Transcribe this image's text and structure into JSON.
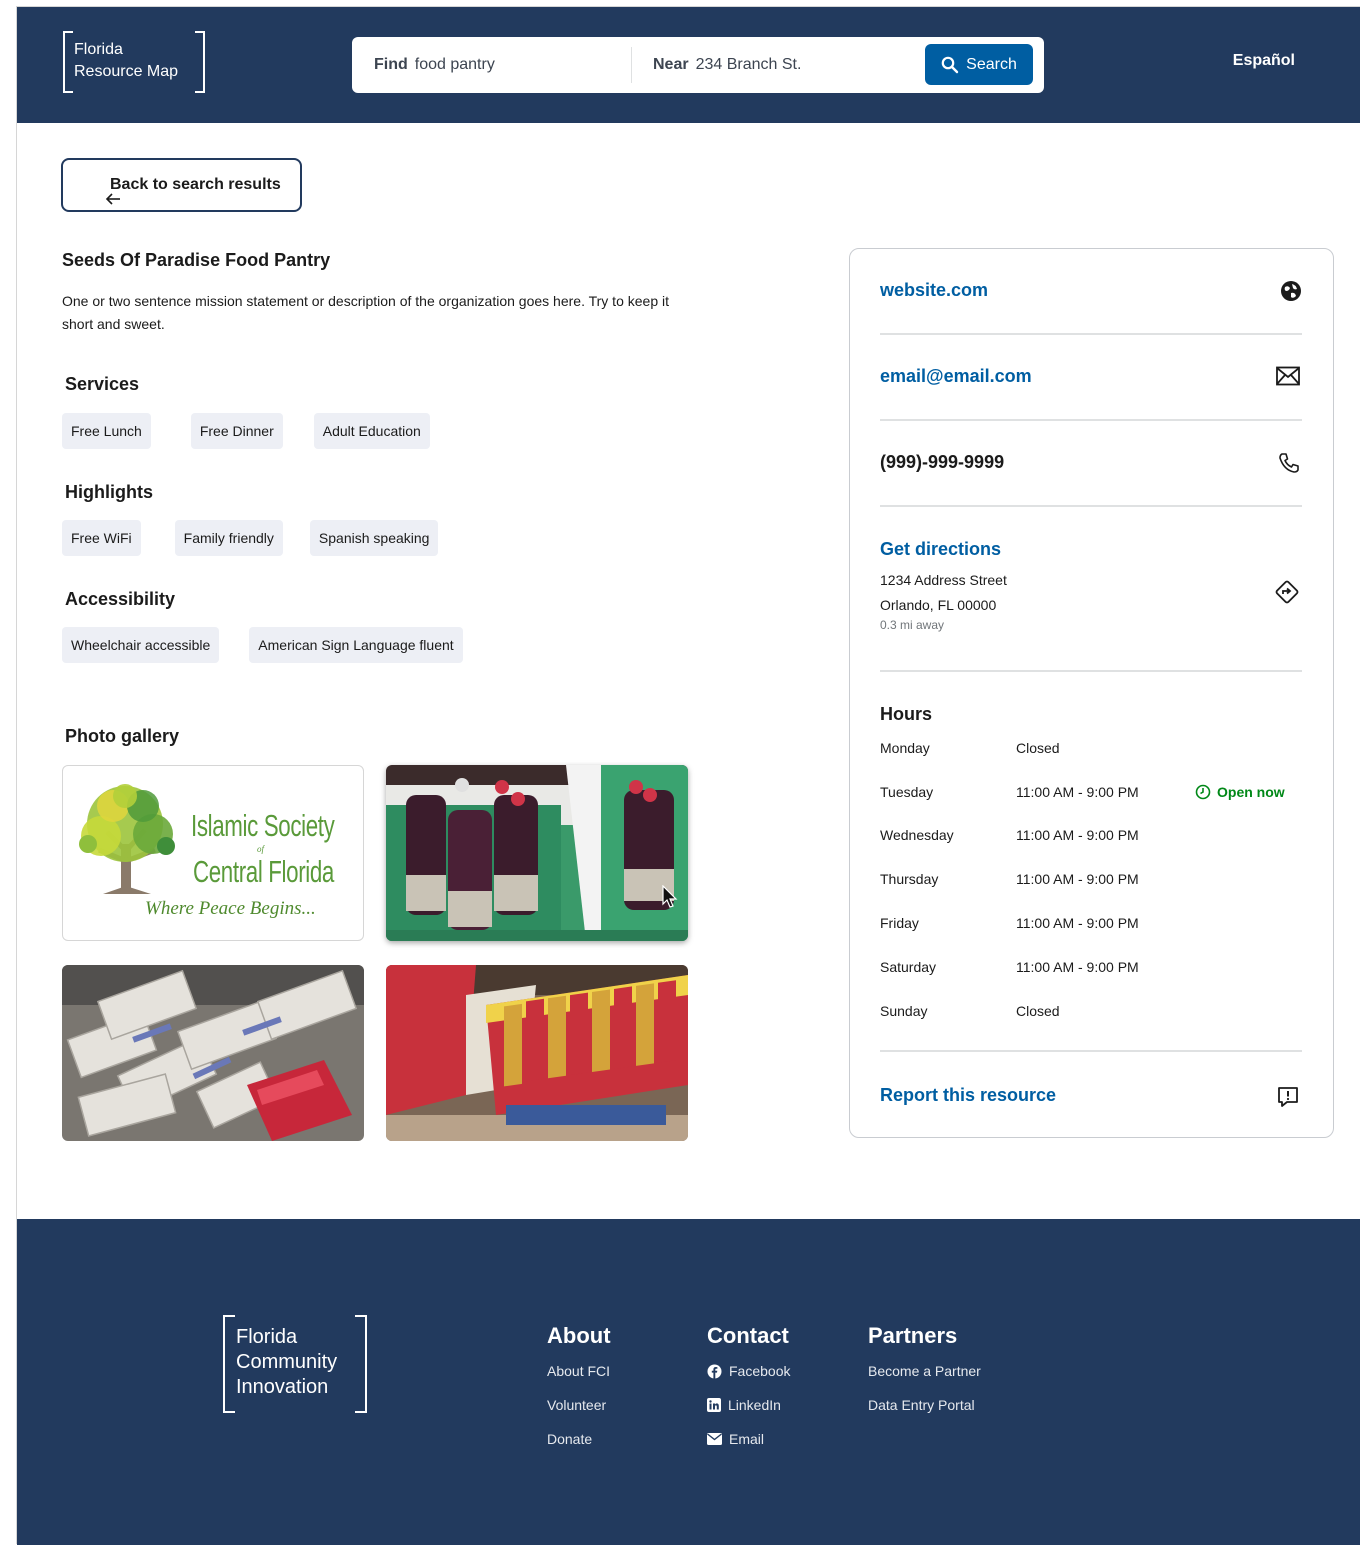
{
  "header": {
    "logo_line1": "Florida",
    "logo_line2": "Resource Map",
    "find_label": "Find",
    "find_value": "food pantry",
    "near_label": "Near",
    "near_value": "234 Branch St.",
    "search_button": "Search",
    "language": "Español"
  },
  "back_button": "Back to search results",
  "organization": {
    "name": "Seeds Of Paradise Food Pantry",
    "description": "One or two sentence mission statement or description of the organization goes here. Try to keep it short and sweet."
  },
  "sections": {
    "services": {
      "title": "Services",
      "tags": [
        "Free Lunch",
        "Free Dinner",
        "Adult Education"
      ]
    },
    "highlights": {
      "title": "Highlights",
      "tags": [
        "Free WiFi",
        "Family friendly",
        "Spanish speaking"
      ]
    },
    "accessibility": {
      "title": "Accessibility",
      "tags": [
        "Wheelchair accessible",
        "American Sign Language fluent"
      ]
    }
  },
  "gallery": {
    "title": "Photo gallery",
    "logo_text_line1": "Islamic Society",
    "logo_text_of": "of",
    "logo_text_line2": "Central Florida",
    "logo_tagline": "Where Peace Begins..."
  },
  "contact": {
    "website": "website.com",
    "email": "email@email.com",
    "phone": "(999)-999-9999",
    "directions_label": "Get directions",
    "address_line1": "1234 Address Street",
    "address_line2": "Orlando, FL 00000",
    "distance": "0.3 mi away"
  },
  "hours": {
    "title": "Hours",
    "rows": [
      {
        "day": "Monday",
        "time": "Closed"
      },
      {
        "day": "Tuesday",
        "time": "11:00 AM - 9:00 PM",
        "status": "Open now"
      },
      {
        "day": "Wednesday",
        "time": "11:00 AM - 9:00 PM"
      },
      {
        "day": "Thursday",
        "time": "11:00 AM - 9:00 PM"
      },
      {
        "day": "Friday",
        "time": "11:00 AM - 9:00 PM"
      },
      {
        "day": "Saturday",
        "time": "11:00 AM - 9:00 PM"
      },
      {
        "day": "Sunday",
        "time": "Closed"
      }
    ]
  },
  "report": "Report this resource",
  "footer": {
    "logo_line1": "Florida",
    "logo_line2": "Community",
    "logo_line3": "Innovation",
    "about": {
      "title": "About",
      "links": [
        "About FCI",
        "Volunteer",
        "Donate"
      ]
    },
    "contact": {
      "title": "Contact",
      "links": [
        "Facebook",
        "LinkedIn",
        "Email"
      ]
    },
    "partners": {
      "title": "Partners",
      "links": [
        "Become a Partner",
        "Data Entry Portal"
      ]
    }
  },
  "colors": {
    "navy": "#223a5e",
    "primary_blue": "#005ea2",
    "tag_bg": "#edeff5",
    "open_green": "#008817"
  }
}
